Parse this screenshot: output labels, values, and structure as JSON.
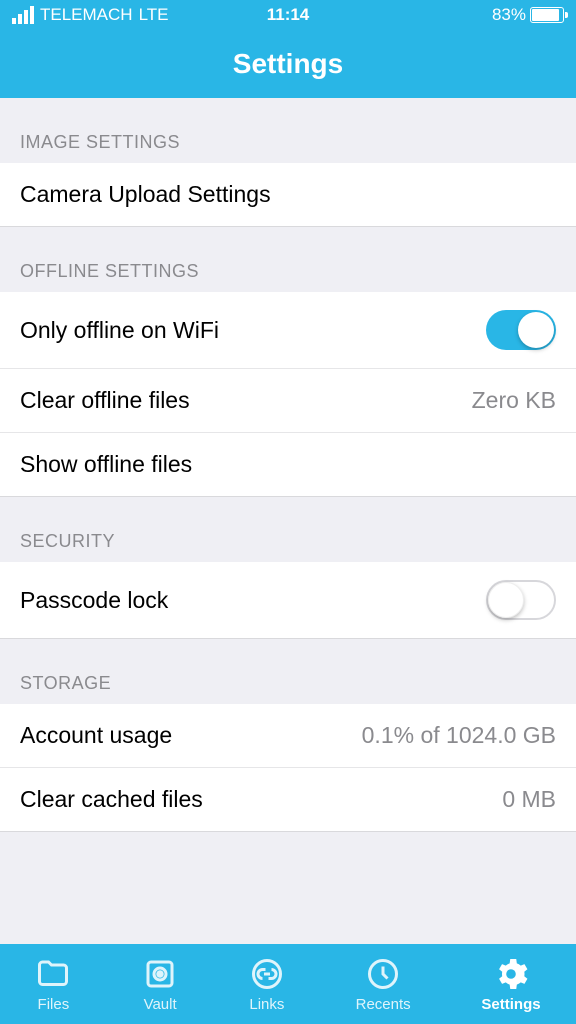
{
  "status": {
    "carrier": "TELEMACH",
    "network": "LTE",
    "time": "11:14",
    "battery_pct": "83%",
    "battery_fill_pct": 83
  },
  "header": {
    "title": "Settings"
  },
  "sections": {
    "image": {
      "title": "IMAGE SETTINGS",
      "camera_upload": "Camera Upload Settings"
    },
    "offline": {
      "title": "OFFLINE SETTINGS",
      "only_wifi": "Only offline on WiFi",
      "only_wifi_on": true,
      "clear_offline": "Clear offline files",
      "clear_offline_value": "Zero KB",
      "show_offline": "Show offline files"
    },
    "security": {
      "title": "SECURITY",
      "passcode": "Passcode lock",
      "passcode_on": false
    },
    "storage": {
      "title": "STORAGE",
      "account_usage": "Account usage",
      "account_usage_value": "0.1% of 1024.0 GB",
      "clear_cached": "Clear cached files",
      "clear_cached_value": "0 MB"
    }
  },
  "tabs": {
    "files": "Files",
    "vault": "Vault",
    "links": "Links",
    "recents": "Recents",
    "settings": "Settings"
  }
}
